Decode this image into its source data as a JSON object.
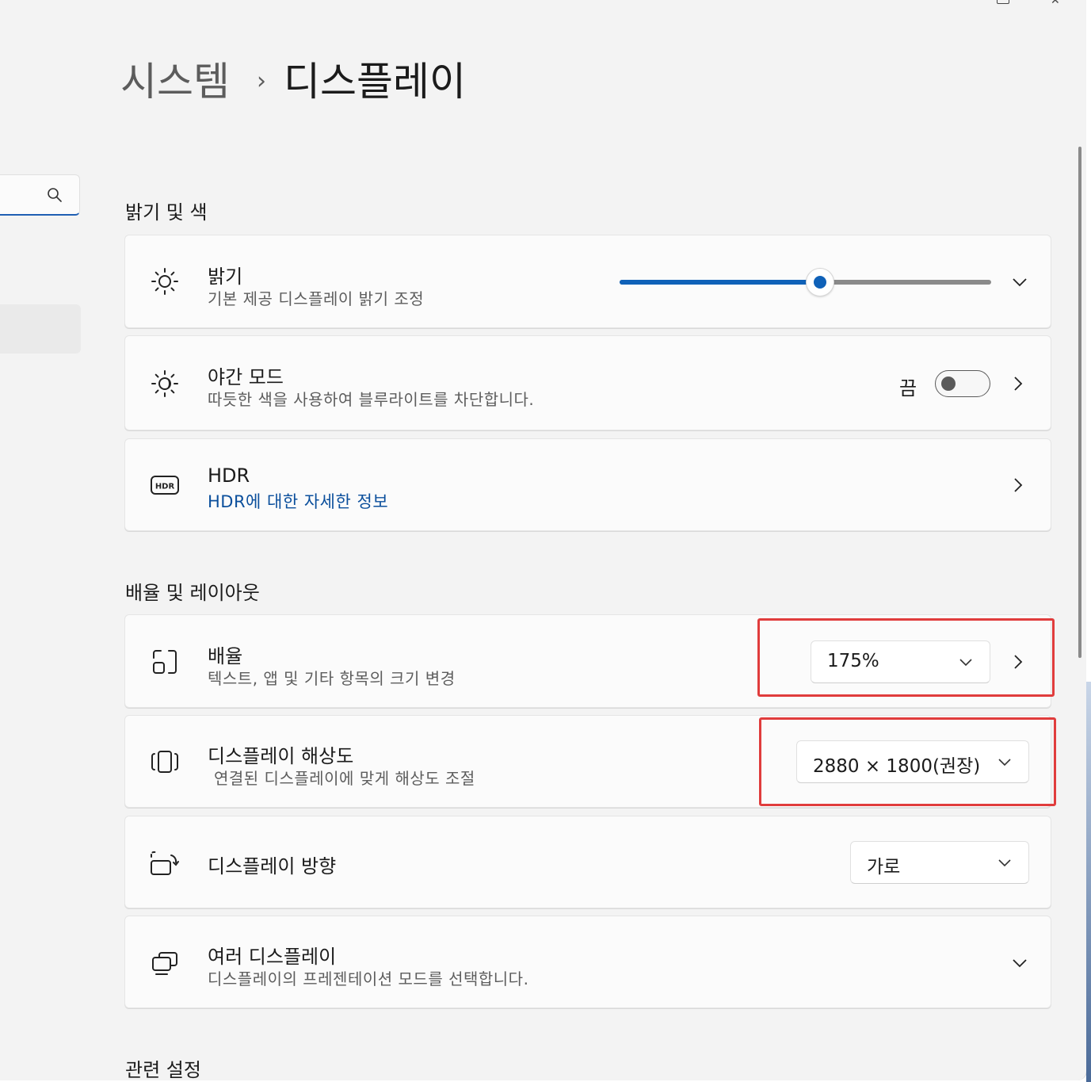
{
  "breadcrumb": {
    "parent": "시스템",
    "separator": "›",
    "current": "디스플레이"
  },
  "sections": {
    "brightness_color": "밝기 및 색",
    "scale_layout": "배율 및 레이아웃",
    "related": "관련 설정"
  },
  "brightness": {
    "title": "밝기",
    "subtitle": "기본 제공 디스플레이 밝기 조정",
    "level_percent": 54,
    "icon": "sun-icon"
  },
  "night_mode": {
    "title": "야간 모드",
    "subtitle": "따듯한 색을 사용하여 블루라이트를 차단합니다.",
    "state_label": "끔",
    "enabled": false,
    "icon": "night-light-icon"
  },
  "hdr": {
    "title": "HDR",
    "link": "HDR에 대한 자세한 정보",
    "icon": "hdr-icon"
  },
  "scale": {
    "title": "배율",
    "subtitle": "텍스트, 앱 및 기타 항목의 크기 변경",
    "value": "175%",
    "icon": "scale-icon"
  },
  "resolution": {
    "title": "디스플레이 해상도",
    "subtitle": "연결된 디스플레이에 맞게 해상도 조절",
    "value": "2880 × 1800(권장)",
    "icon": "resolution-icon"
  },
  "orientation": {
    "title": "디스플레이 방향",
    "value": "가로",
    "icon": "orientation-icon"
  },
  "multi_display": {
    "title": "여러 디스플레이",
    "subtitle": "디스플레이의 프레젠테이션 모드를 선택합니다.",
    "icon": "multiple-displays-icon"
  },
  "colors": {
    "accent": "#0f61b8",
    "link": "#0b4f9c",
    "highlight": "#e03c3c"
  }
}
